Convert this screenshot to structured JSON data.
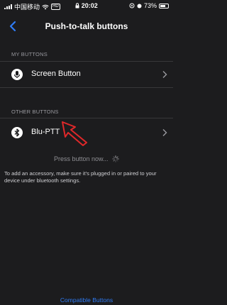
{
  "status_bar": {
    "carrier": "中国移动",
    "time": "20:02",
    "battery": "73%",
    "battery_level": 0.73,
    "hd_badge": "HD"
  },
  "nav": {
    "title": "Push-to-talk buttons",
    "back_icon": "chevron-left-icon"
  },
  "sections": {
    "my_buttons": {
      "header": "MY BUTTONS",
      "item_label": "Screen Button",
      "item_icon": "microphone-icon"
    },
    "other_buttons": {
      "header": "OTHER BUTTONS",
      "item_label": "Blu-PTT",
      "item_icon": "bluetooth-icon"
    }
  },
  "press_text": "Press button now...",
  "info_text": "To add an accessory, make sure it's plugged in or paired to your device under bluetooth settings.",
  "footer_link": "Compatible Buttons",
  "colors": {
    "background": "#1c1c1e",
    "accent": "#2f7cf6",
    "annotation": "#e0282a",
    "secondary_text": "#9a9aa0"
  }
}
